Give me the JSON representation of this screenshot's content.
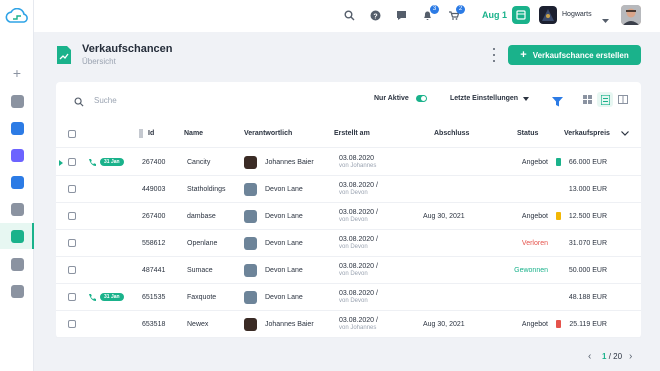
{
  "sidebar": {
    "items": [
      {
        "name": "add",
        "color": "#8b93a1"
      },
      {
        "name": "dashboard",
        "color": "#8b93a1"
      },
      {
        "name": "database",
        "color": "#2c7be5"
      },
      {
        "name": "notes",
        "color": "#6c63ff"
      },
      {
        "name": "network",
        "color": "#2c7be5"
      },
      {
        "name": "building",
        "color": "#8b93a1"
      },
      {
        "name": "opportunities",
        "color": "#1ab28b"
      },
      {
        "name": "contacts",
        "color": "#8b93a1"
      },
      {
        "name": "briefcase",
        "color": "#8b93a1"
      }
    ]
  },
  "topbar": {
    "notification_count": "3",
    "cart_count": "2",
    "date": "Aug 1",
    "organization": "Hogwarts"
  },
  "header": {
    "title": "Verkaufschancen",
    "subtitle": "Übersicht",
    "create_button": "Verkaufschance erstellen"
  },
  "toolbar": {
    "search_placeholder": "Suche",
    "only_active_label": "Nur Aktive",
    "only_active_on": true,
    "settings_label": "Letzte Einstellungen"
  },
  "table": {
    "columns": {
      "id": "Id",
      "name": "Name",
      "responsible": "Verantwortlich",
      "created": "Erstellt am",
      "closing": "Abschluss",
      "status": "Status",
      "price": "Verkaufspreis"
    },
    "rows": [
      {
        "badge": "31 Jan",
        "id": "267400",
        "name": "Cancity",
        "responsible": "Johannes Baier",
        "avatar": "dark",
        "created": "03.08.2020",
        "created_by": "von Johannes",
        "closing": "",
        "status": "Angebot",
        "status_color": "#2b3340",
        "status_icon": "#1ab28b",
        "price": "66.000 EUR"
      },
      {
        "badge": "",
        "id": "449003",
        "name": "Statholdings",
        "responsible": "Devon Lane",
        "avatar": "light",
        "created": "03.08.2020 /",
        "created_by": "von Devon",
        "closing": "",
        "status": "",
        "status_color": "#2b3340",
        "status_icon": "",
        "price": "13.000 EUR"
      },
      {
        "badge": "",
        "id": "267400",
        "name": "dambase",
        "responsible": "Devon Lane",
        "avatar": "light",
        "created": "03.08.2020 /",
        "created_by": "von Devon",
        "closing": "Aug 30, 2021",
        "status": "Angebot",
        "status_color": "#2b3340",
        "status_icon": "#f2b705",
        "price": "12.500 EUR"
      },
      {
        "badge": "",
        "id": "558612",
        "name": "Openlane",
        "responsible": "Devon Lane",
        "avatar": "light",
        "created": "03.08.2020 /",
        "created_by": "von Devon",
        "closing": "",
        "status": "Verloren",
        "status_color": "#e5534b",
        "status_icon": "",
        "price": "31.070 EUR"
      },
      {
        "badge": "",
        "id": "487441",
        "name": "Sumace",
        "responsible": "Devon Lane",
        "avatar": "light",
        "created": "03.08.2020 /",
        "created_by": "von Devon",
        "closing": "",
        "status": "Gewonnen",
        "status_color": "#1ab28b",
        "status_icon": "",
        "price": "50.000 EUR"
      },
      {
        "badge": "31 Jan",
        "id": "651535",
        "name": "Faxquote",
        "responsible": "Devon Lane",
        "avatar": "light",
        "created": "03.08.2020 /",
        "created_by": "von Devon",
        "closing": "",
        "status": "",
        "status_color": "#2b3340",
        "status_icon": "",
        "price": "48.188 EUR"
      },
      {
        "badge": "",
        "id": "653518",
        "name": "Newex",
        "responsible": "Johannes Baier",
        "avatar": "dark",
        "created": "03.08.2020 /",
        "created_by": "von Johannes",
        "closing": "Aug 30, 2021",
        "status": "Angebot",
        "status_color": "#2b3340",
        "status_icon": "#e5534b",
        "price": "25.119 EUR"
      }
    ]
  },
  "pagination": {
    "current": "1",
    "total": "/ 20"
  }
}
